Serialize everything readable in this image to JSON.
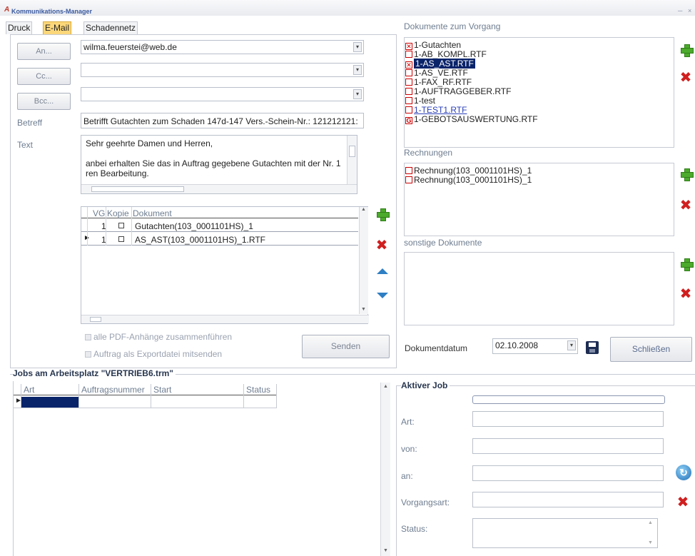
{
  "window": {
    "title": "Kommunikations-Manager"
  },
  "tabs": [
    {
      "label": "Druck"
    },
    {
      "label": "E-Mail"
    },
    {
      "label": "Schadennetz"
    }
  ],
  "email": {
    "to_button": "An...",
    "cc_button": "Cc...",
    "bcc_button": "Bcc...",
    "to_value": "wilma.feuerstei@web.de",
    "cc_value": "",
    "bcc_value": "",
    "subject_label": "Betreff",
    "subject_value": "Betrifft Gutachten zum Schaden 147d-147  Vers.-Schein-Nr.: 121212121:",
    "text_label": "Text",
    "text_lines": [
      "Sehr geehrte Damen und Herren,",
      "",
      "anbei erhalten Sie das in Auftrag gegebene Gutachten mit der  Nr.  1",
      "ren Bearbeitung."
    ]
  },
  "attachments": {
    "headers": {
      "vg": "VG",
      "kopie": "Kopie",
      "dokument": "Dokument"
    },
    "rows": [
      {
        "vg": "1",
        "dokument": "Gutachten(103_0001101HS)_1"
      },
      {
        "vg": "1",
        "dokument": "AS_AST(103_0001101HS)_1.RTF"
      }
    ],
    "merge_pdf_label": "alle PDF-Anhänge zusammenführen",
    "export_label": "Auftrag als Exportdatei mitsenden",
    "send_button": "Senden"
  },
  "documents": {
    "title": "Dokumente zum Vorgang",
    "items": [
      {
        "label": "1-Gutachten",
        "state": "checked"
      },
      {
        "label": "1-AB_KOMPL.RTF",
        "state": "empty"
      },
      {
        "label": "1-AS_AST.RTF",
        "state": "checked-selected"
      },
      {
        "label": "1-AS_VE.RTF",
        "state": "empty"
      },
      {
        "label": "1-FAX_RF.RTF",
        "state": "empty"
      },
      {
        "label": "1-AUFTRAGGEBER.RTF",
        "state": "empty"
      },
      {
        "label": "1-test",
        "state": "empty"
      },
      {
        "label": "1-TEST1.RTF",
        "state": "link"
      },
      {
        "label": "1-GEBOTSAUSWERTUNG.RTF",
        "state": "g"
      }
    ],
    "invoices_title": "Rechnungen",
    "invoices": [
      {
        "label": "Rechnung(103_0001101HS)_1"
      },
      {
        "label": "Rechnung(103_0001101HS)_1"
      }
    ],
    "other_title": "sonstige Dokumente",
    "date_label": "Dokumentdatum",
    "date_value": "02.10.2008",
    "close_button": "Schließen"
  },
  "jobs": {
    "title": "Jobs am Arbeitsplatz \"VERTRIEB6.trm\"",
    "headers": [
      "Art",
      "Auftragsnummer",
      "Start",
      "Status"
    ]
  },
  "active_job": {
    "title": "Aktiver Job",
    "art_label": "Art:",
    "von_label": "von:",
    "an_label": "an:",
    "vorgangsart_label": "Vorgangsart:",
    "status_label": "Status:"
  },
  "colors": {
    "active_tab": "#fbd77a",
    "selection": "#0a246a",
    "delete_red": "#d01f1f",
    "add_green": "#4caa2c",
    "arrow_blue": "#2e7fc4"
  }
}
